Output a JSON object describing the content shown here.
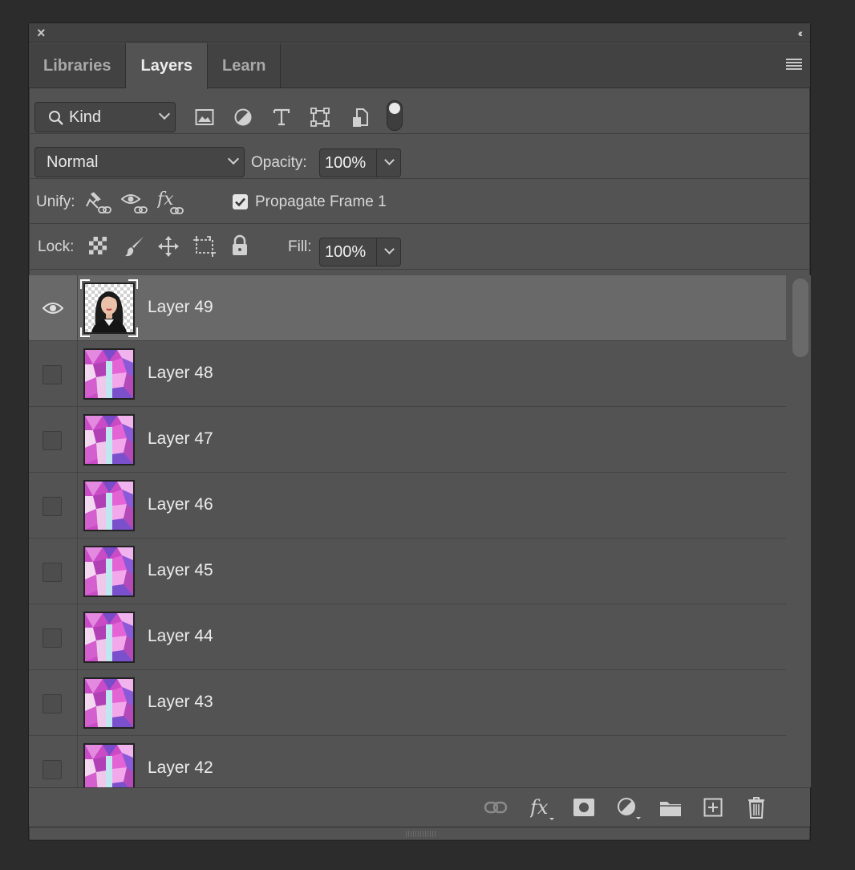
{
  "panel": {
    "tabs": [
      {
        "label": "Libraries",
        "active": false
      },
      {
        "label": "Layers",
        "active": true
      },
      {
        "label": "Learn",
        "active": false
      }
    ]
  },
  "filter": {
    "kind_label": "Kind",
    "filter_icons": [
      "image-filter-icon",
      "adjustment-filter-icon",
      "type-filter-icon",
      "shape-filter-icon",
      "smart-object-filter-icon"
    ]
  },
  "blend": {
    "mode": "Normal",
    "opacity_label": "Opacity:",
    "opacity_value": "100%"
  },
  "unify": {
    "label": "Unify:",
    "propagate_label": "Propagate Frame 1",
    "propagate_checked": true
  },
  "lock": {
    "label": "Lock:",
    "fill_label": "Fill:",
    "fill_value": "100%"
  },
  "layers": [
    {
      "name": "Layer 49",
      "visible": true,
      "selected": true,
      "thumb": "portrait"
    },
    {
      "name": "Layer 48",
      "visible": false,
      "selected": false,
      "thumb": "pattern"
    },
    {
      "name": "Layer 47",
      "visible": false,
      "selected": false,
      "thumb": "pattern"
    },
    {
      "name": "Layer 46",
      "visible": false,
      "selected": false,
      "thumb": "pattern"
    },
    {
      "name": "Layer 45",
      "visible": false,
      "selected": false,
      "thumb": "pattern"
    },
    {
      "name": "Layer 44",
      "visible": false,
      "selected": false,
      "thumb": "pattern"
    },
    {
      "name": "Layer 43",
      "visible": false,
      "selected": false,
      "thumb": "pattern"
    },
    {
      "name": "Layer 42",
      "visible": false,
      "selected": false,
      "thumb": "pattern"
    }
  ],
  "footer_icons": [
    "link-layers-icon",
    "fx-icon",
    "layer-mask-icon",
    "adjustment-layer-icon",
    "group-folder-icon",
    "new-layer-icon",
    "trash-icon"
  ],
  "colors": {
    "panel_bg": "#535353",
    "selected_row": "#696969",
    "thumb_pink": "#d64fc8",
    "thumb_violet": "#7b4fd0"
  }
}
